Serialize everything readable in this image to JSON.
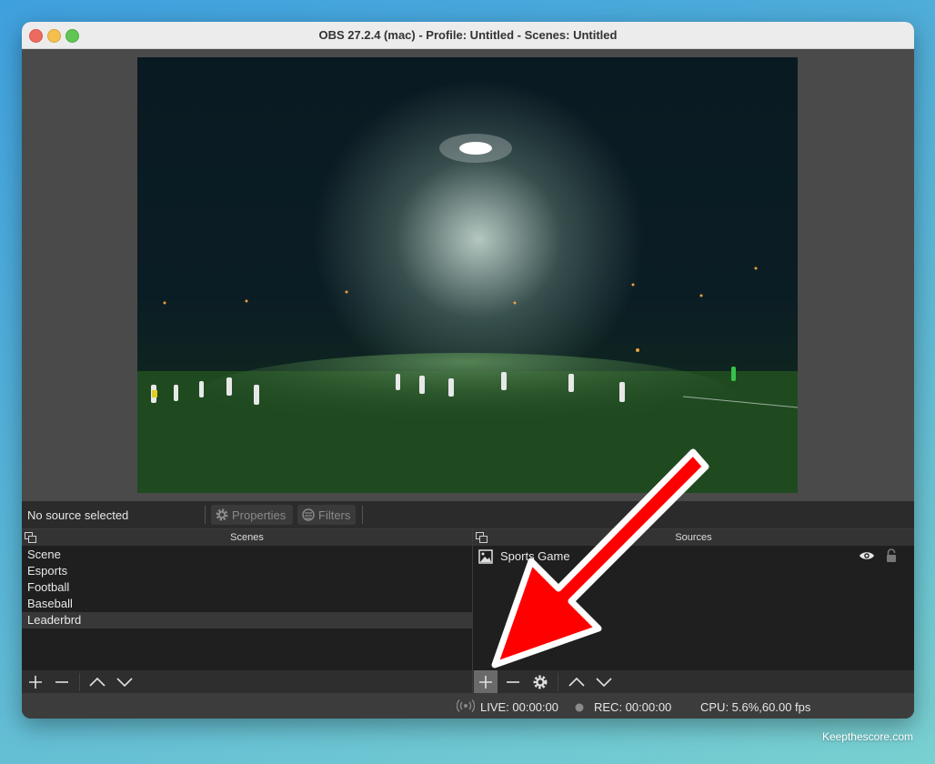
{
  "window": {
    "title": "OBS 27.2.4 (mac) - Profile: Untitled - Scenes: Untitled"
  },
  "toolbar": {
    "no_source": "No source selected",
    "properties_label": "Properties",
    "filters_label": "Filters"
  },
  "scenes": {
    "header": "Scenes",
    "items": [
      "Scene",
      "Esports",
      "Football",
      "Baseball",
      "Leaderbrd"
    ],
    "selected_index": 4
  },
  "sources": {
    "header": "Sources",
    "items": [
      {
        "label": "Sports Game",
        "icon": "image-source-icon",
        "visible_icon": "eye-icon",
        "lock_icon": "lock-icon"
      }
    ]
  },
  "statusbar": {
    "live": "LIVE: 00:00:00",
    "rec": "REC: 00:00:00",
    "cpu": "CPU: 5.6%,60.00 fps"
  },
  "watermark": "Keepthescore.com",
  "colors": {
    "annotation_arrow": "#ff0000",
    "window_bg": "#3c3c3c",
    "panel_bg": "#1f1f1f"
  }
}
